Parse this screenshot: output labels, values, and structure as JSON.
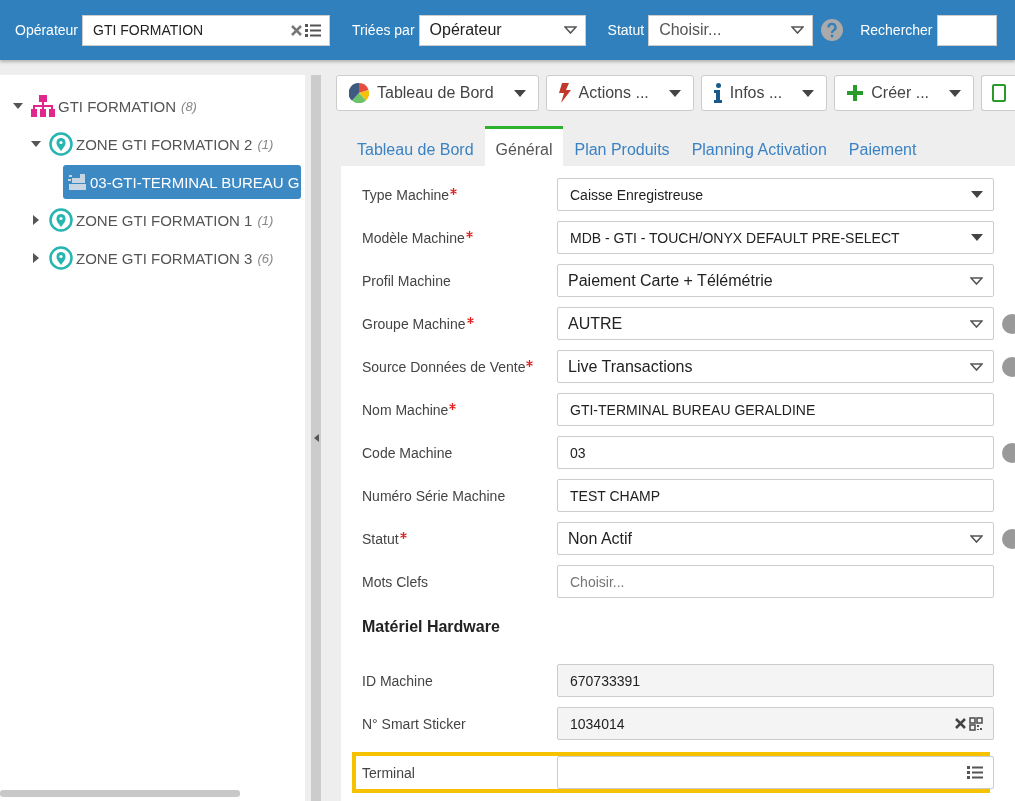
{
  "top_bar": {
    "operator": {
      "label": "Opérateur",
      "value": "GTI FORMATION"
    },
    "sort": {
      "label": "Triées par",
      "value": "Opérateur"
    },
    "status": {
      "label": "Statut",
      "placeholder": "Choisir..."
    },
    "search": {
      "label": "Rechercher"
    }
  },
  "tree": [
    {
      "label": "GTI FORMATION",
      "count": "(8)",
      "kind": "operator",
      "expanded": true,
      "selected": false,
      "children": [
        {
          "label": "ZONE GTI FORMATION 2",
          "count": "(1)",
          "kind": "zone",
          "expanded": true,
          "selected": false,
          "children": [
            {
              "label": "03-GTI-TERMINAL BUREAU G",
              "kind": "machine",
              "selected": true
            }
          ]
        },
        {
          "label": "ZONE GTI FORMATION 1",
          "count": "(1)",
          "kind": "zone",
          "expanded": false,
          "selected": false
        },
        {
          "label": "ZONE GTI FORMATION 3",
          "count": "(6)",
          "kind": "zone",
          "expanded": false,
          "selected": false
        }
      ]
    }
  ],
  "toolbar": [
    {
      "label": "Tableau de Bord",
      "kind": "dashboard"
    },
    {
      "label": "Actions ...",
      "kind": "actions"
    },
    {
      "label": "Infos ...",
      "kind": "info"
    },
    {
      "label": "Créer ...",
      "kind": "create"
    },
    {
      "kind": "document"
    }
  ],
  "tabs": [
    {
      "label": "Tableau de Bord",
      "selected": false
    },
    {
      "label": "Général",
      "selected": true
    },
    {
      "label": "Plan Produits",
      "selected": false
    },
    {
      "label": "Planning Activation",
      "selected": false
    },
    {
      "label": "Paiement",
      "selected": false
    }
  ],
  "form": [
    {
      "kind": "dropdown",
      "label": "Type Machine",
      "required": true,
      "value": "Caisse Enregistreuse",
      "help": false
    },
    {
      "kind": "dropdown",
      "label": "Modèle Machine",
      "required": true,
      "value": "MDB - GTI - TOUCH/ONYX DEFAULT PRE-SELECT",
      "help": false
    },
    {
      "kind": "combo",
      "label": "Profil Machine",
      "required": false,
      "value": "Paiement Carte + Télémétrie",
      "help": false
    },
    {
      "kind": "combo",
      "label": "Groupe Machine",
      "required": true,
      "value": "AUTRE",
      "help": true
    },
    {
      "kind": "combo",
      "label": "Source Données de Vente",
      "required": true,
      "value": "Live Transactions",
      "help": true
    },
    {
      "kind": "text",
      "label": "Nom Machine",
      "required": true,
      "value": "GTI-TERMINAL BUREAU GERALDINE",
      "help": false
    },
    {
      "kind": "text",
      "label": "Code Machine",
      "required": false,
      "value": "03",
      "help": true
    },
    {
      "kind": "text",
      "label": "Numéro Série Machine",
      "required": false,
      "value": "TEST CHAMP",
      "help": false
    },
    {
      "kind": "combo",
      "label": "Statut",
      "required": true,
      "value": "Non Actif",
      "help": true
    },
    {
      "kind": "tags",
      "label": "Mots Clefs",
      "required": false,
      "placeholder": "Choisir...",
      "help": false
    },
    {
      "kind": "section",
      "label": "Matériel Hardware"
    },
    {
      "kind": "readonly",
      "label": "ID Machine",
      "required": false,
      "value": "670733391",
      "help": false
    },
    {
      "kind": "sticker",
      "label": "N° Smart Sticker",
      "required": false,
      "value": "1034014",
      "help": false
    },
    {
      "kind": "picker",
      "label": "Terminal",
      "required": false,
      "help": false,
      "highlighted": true
    }
  ]
}
